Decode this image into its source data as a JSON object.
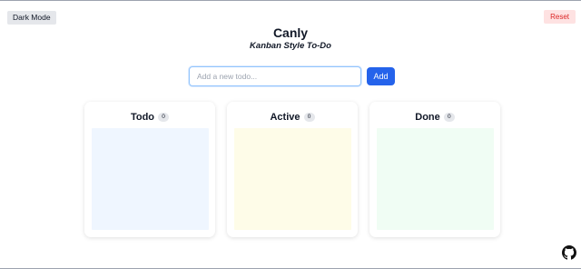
{
  "header": {
    "dark_mode_label": "Dark Mode",
    "reset_label": "Reset",
    "title": "Canly",
    "subtitle": "Kanban Style To-Do"
  },
  "new_todo": {
    "placeholder": "Add a new todo...",
    "value": "",
    "add_label": "Add"
  },
  "columns": [
    {
      "title": "Todo",
      "count": "0",
      "zone_color": "#eff6ff"
    },
    {
      "title": "Active",
      "count": "0",
      "zone_color": "#fefce8"
    },
    {
      "title": "Done",
      "count": "0",
      "zone_color": "#f0fdf4"
    }
  ],
  "colors": {
    "accent": "#2563eb",
    "reset_bg": "#fee2e2",
    "reset_text": "#dc2626"
  },
  "footer": {
    "github_icon": "github-icon"
  }
}
